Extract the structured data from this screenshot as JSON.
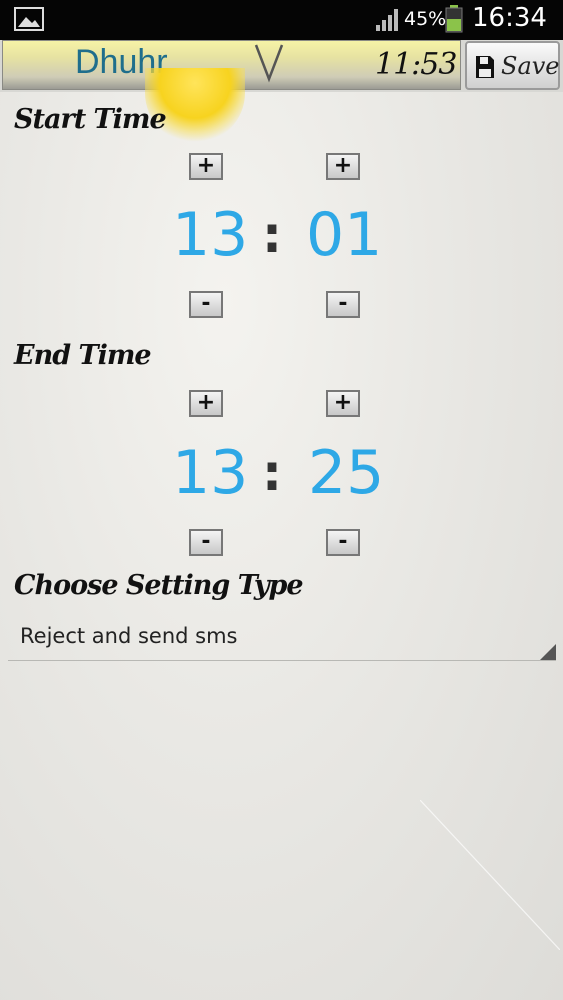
{
  "status_bar": {
    "battery_percent": "45%",
    "time": "16:34",
    "icons": [
      "gallery-icon",
      "signal-icon",
      "battery-icon"
    ]
  },
  "header": {
    "prayer_name": "Dhuhr",
    "prayer_time": "11:53",
    "save_label": "Save"
  },
  "start_time": {
    "label": "Start Time",
    "hour": "13",
    "separator": ":",
    "minute": "01",
    "plus": "+",
    "minus": "-"
  },
  "end_time": {
    "label": "End Time",
    "hour": "13",
    "separator": ":",
    "minute": "25",
    "plus": "+",
    "minus": "-"
  },
  "setting_type": {
    "label": "Choose Setting Type",
    "selected": "Reject and send sms"
  },
  "colors": {
    "digit": "#2ea8e6",
    "prayer_name": "#1f6e8c",
    "header_yellow": "#f6f3a6"
  }
}
